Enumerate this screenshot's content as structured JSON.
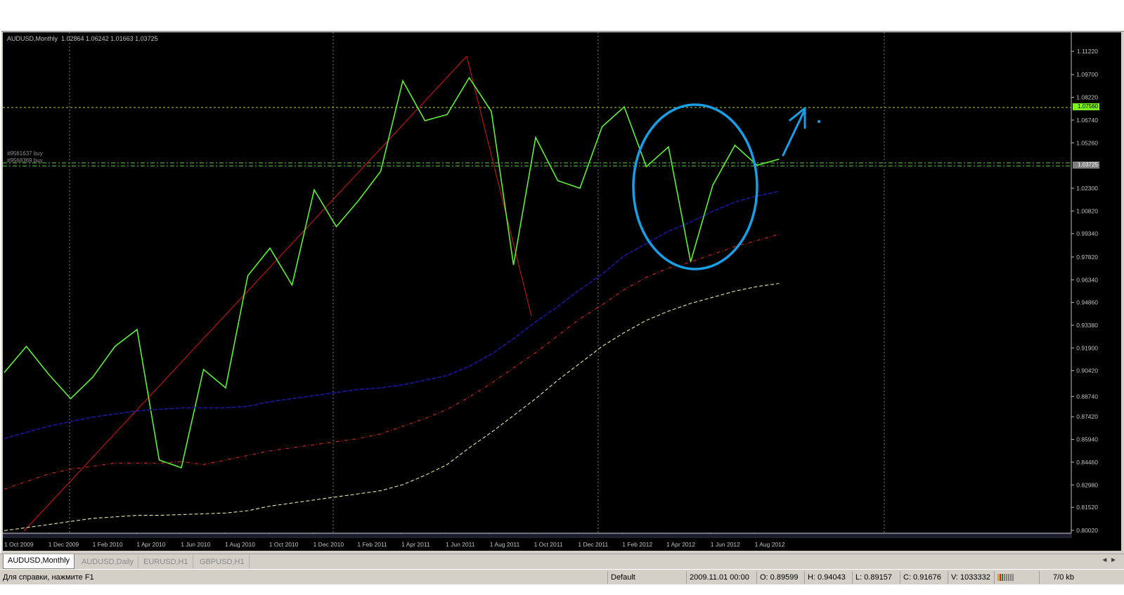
{
  "window": {
    "chart_header": "AUDUSD,Monthly  1.02864 1.06242 1.01663 1.03725"
  },
  "orders": [
    {
      "label": "#9561637 buy"
    },
    {
      "label": "#9568369 buy"
    }
  ],
  "price_axis": {
    "ticks": [
      "1.11220",
      "1.09700",
      "1.08220",
      "1.06740",
      "1.05260",
      "1.02300",
      "1.00820",
      "0.99340",
      "0.97820",
      "0.96340",
      "0.94860",
      "0.93380",
      "0.91900",
      "0.90420",
      "0.88740",
      "0.87420",
      "0.85940",
      "0.84460",
      "0.82980",
      "0.81520",
      "0.80020"
    ],
    "bid_badge": "1.07560",
    "last_badge": "1.03725"
  },
  "time_axis": {
    "ticks": [
      "1 Oct 2009",
      "1 Dec 2009",
      "1 Feb 2010",
      "1 Apr 2010",
      "1 Jun 2010",
      "1 Aug 2010",
      "1 Oct 2010",
      "1 Dec 2010",
      "1 Feb 2011",
      "1 Apr 2011",
      "1 Jun 2011",
      "1 Aug 2011",
      "1 Oct 2011",
      "1 Dec 2011",
      "1 Feb 2012",
      "1 Apr 2012",
      "1 Jun 2012",
      "1 Aug 2012"
    ]
  },
  "tabs": [
    {
      "label": "AUDUSD,Monthly",
      "active": true
    },
    {
      "label": "AUDUSD,Daily",
      "active": false
    },
    {
      "label": "EURUSD,H1",
      "active": false
    },
    {
      "label": "GBPUSD,H1",
      "active": false
    }
  ],
  "tab_scroll_glyph": "◄ ►",
  "status": {
    "help": "Для справки, нажмите F1",
    "profile": "Default",
    "datetime": "2009.11.01 00:00",
    "open": "O: 0.89599",
    "high": "H: 0.94043",
    "low": "L: 0.89157",
    "close": "C: 0.91676",
    "volume": "V: 1033332",
    "traffic": "7/0 kb"
  },
  "colors": {
    "price_line": "#5ef03a",
    "ma_blue": "#1a1aa8",
    "ma_red": "#c8261a",
    "ma_yellow": "#e6e6a0",
    "trend_red": "#d21a14",
    "annotation_blue": "#1a9ee6",
    "grid": "#9a9a9a"
  },
  "chart_data": {
    "type": "line",
    "symbol": "AUDUSD",
    "timeframe": "Monthly",
    "ylim": [
      0.8002,
      1.1122
    ],
    "x": [
      "2009-10",
      "2009-11",
      "2009-12",
      "2010-01",
      "2010-02",
      "2010-03",
      "2010-04",
      "2010-05",
      "2010-06",
      "2010-07",
      "2010-08",
      "2010-09",
      "2010-10",
      "2010-11",
      "2010-12",
      "2011-01",
      "2011-02",
      "2011-03",
      "2011-04",
      "2011-05",
      "2011-06",
      "2011-07",
      "2011-08",
      "2011-09",
      "2011-10",
      "2011-11",
      "2011-12",
      "2012-01",
      "2012-02",
      "2012-03",
      "2012-04",
      "2012-05",
      "2012-06",
      "2012-07",
      "2012-08",
      "2012-09"
    ],
    "series": [
      {
        "values": [
          0.903,
          0.92,
          0.902,
          0.886,
          0.9,
          0.92,
          0.931,
          0.846,
          0.841,
          0.905,
          0.893,
          0.966,
          0.984,
          0.96,
          1.022,
          0.998,
          1.015,
          1.034,
          1.093,
          1.067,
          1.071,
          1.095,
          1.073,
          0.973,
          1.056,
          1.028,
          1.023,
          1.063,
          1.076,
          1.037,
          1.05,
          0.975,
          1.025,
          1.051,
          1.038,
          1.042
        ]
      },
      {
        "values": [
          0.86,
          0.864,
          0.868,
          0.871,
          0.874,
          0.876,
          0.878,
          0.879,
          0.88,
          0.88,
          0.88,
          0.881,
          0.884,
          0.886,
          0.888,
          0.89,
          0.892,
          0.893,
          0.895,
          0.898,
          0.901,
          0.907,
          0.915,
          0.925,
          0.936,
          0.946,
          0.957,
          0.967,
          0.979,
          0.987,
          0.995,
          1.001,
          1.008,
          1.014,
          1.018,
          1.021
        ]
      },
      {
        "values": [
          0.827,
          0.832,
          0.837,
          0.84,
          0.842,
          0.844,
          0.844,
          0.844,
          0.845,
          0.843,
          0.846,
          0.849,
          0.852,
          0.854,
          0.856,
          0.858,
          0.86,
          0.863,
          0.868,
          0.873,
          0.879,
          0.887,
          0.896,
          0.906,
          0.916,
          0.927,
          0.938,
          0.947,
          0.957,
          0.965,
          0.971,
          0.975,
          0.98,
          0.985,
          0.989,
          0.993
        ]
      },
      {
        "values": [
          0.8,
          0.802,
          0.804,
          0.806,
          0.808,
          0.809,
          0.81,
          0.81,
          0.8105,
          0.811,
          0.8115,
          0.813,
          0.816,
          0.818,
          0.82,
          0.822,
          0.824,
          0.826,
          0.83,
          0.836,
          0.843,
          0.854,
          0.864,
          0.875,
          0.886,
          0.898,
          0.909,
          0.92,
          0.929,
          0.937,
          0.943,
          0.948,
          0.952,
          0.956,
          0.959,
          0.961
        ]
      }
    ],
    "order_levels": [
      1.0395,
      1.0375
    ],
    "bid_level": 1.0756,
    "grid": true
  }
}
